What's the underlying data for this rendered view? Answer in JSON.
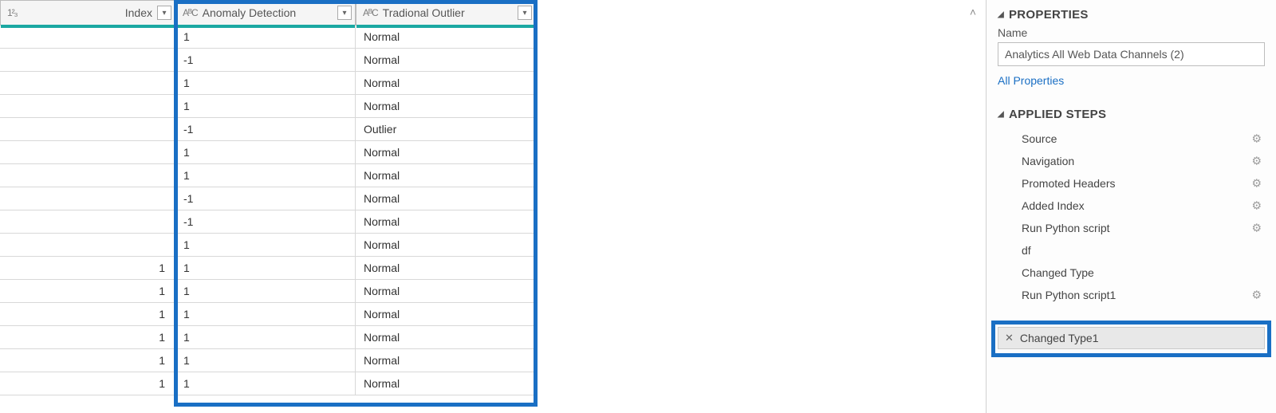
{
  "grid": {
    "columns": {
      "index": {
        "type_icon": "1²₃",
        "label": "Index"
      },
      "anomaly": {
        "type_icon": "AᴮC",
        "label": "Anomaly Detection"
      },
      "outlier": {
        "type_icon": "AᴮC",
        "label": "Tradional Outlier"
      }
    },
    "rows": [
      {
        "index": "",
        "anomaly": "1",
        "outlier": "Normal"
      },
      {
        "index": "",
        "anomaly": "-1",
        "outlier": "Normal"
      },
      {
        "index": "",
        "anomaly": "1",
        "outlier": "Normal"
      },
      {
        "index": "",
        "anomaly": "1",
        "outlier": "Normal"
      },
      {
        "index": "",
        "anomaly": "-1",
        "outlier": "Outlier"
      },
      {
        "index": "",
        "anomaly": "1",
        "outlier": "Normal"
      },
      {
        "index": "",
        "anomaly": "1",
        "outlier": "Normal"
      },
      {
        "index": "",
        "anomaly": "-1",
        "outlier": "Normal"
      },
      {
        "index": "",
        "anomaly": "-1",
        "outlier": "Normal"
      },
      {
        "index": "",
        "anomaly": "1",
        "outlier": "Normal"
      },
      {
        "index": "1",
        "anomaly": "1",
        "outlier": "Normal"
      },
      {
        "index": "1",
        "anomaly": "1",
        "outlier": "Normal"
      },
      {
        "index": "1",
        "anomaly": "1",
        "outlier": "Normal"
      },
      {
        "index": "1",
        "anomaly": "1",
        "outlier": "Normal"
      },
      {
        "index": "1",
        "anomaly": "1",
        "outlier": "Normal"
      },
      {
        "index": "1",
        "anomaly": "1",
        "outlier": "Normal"
      }
    ]
  },
  "panel": {
    "properties_title": "PROPERTIES",
    "name_label": "Name",
    "name_value": "Analytics All Web Data Channels (2)",
    "all_properties": "All Properties",
    "applied_steps_title": "APPLIED STEPS",
    "steps": [
      {
        "label": "Source",
        "gear": true
      },
      {
        "label": "Navigation",
        "gear": true
      },
      {
        "label": "Promoted Headers",
        "gear": true
      },
      {
        "label": "Added Index",
        "gear": true
      },
      {
        "label": "Run Python script",
        "gear": true
      },
      {
        "label": "df",
        "gear": false
      },
      {
        "label": "Changed Type",
        "gear": false
      },
      {
        "label": "Run Python script1",
        "gear": true
      }
    ],
    "selected_step": {
      "close": "✕",
      "label": "Changed Type1"
    }
  },
  "icons": {
    "filter_glyph": "▾",
    "gear_glyph": "⚙",
    "tri_glyph": "◢",
    "scroll_up": "˄"
  }
}
